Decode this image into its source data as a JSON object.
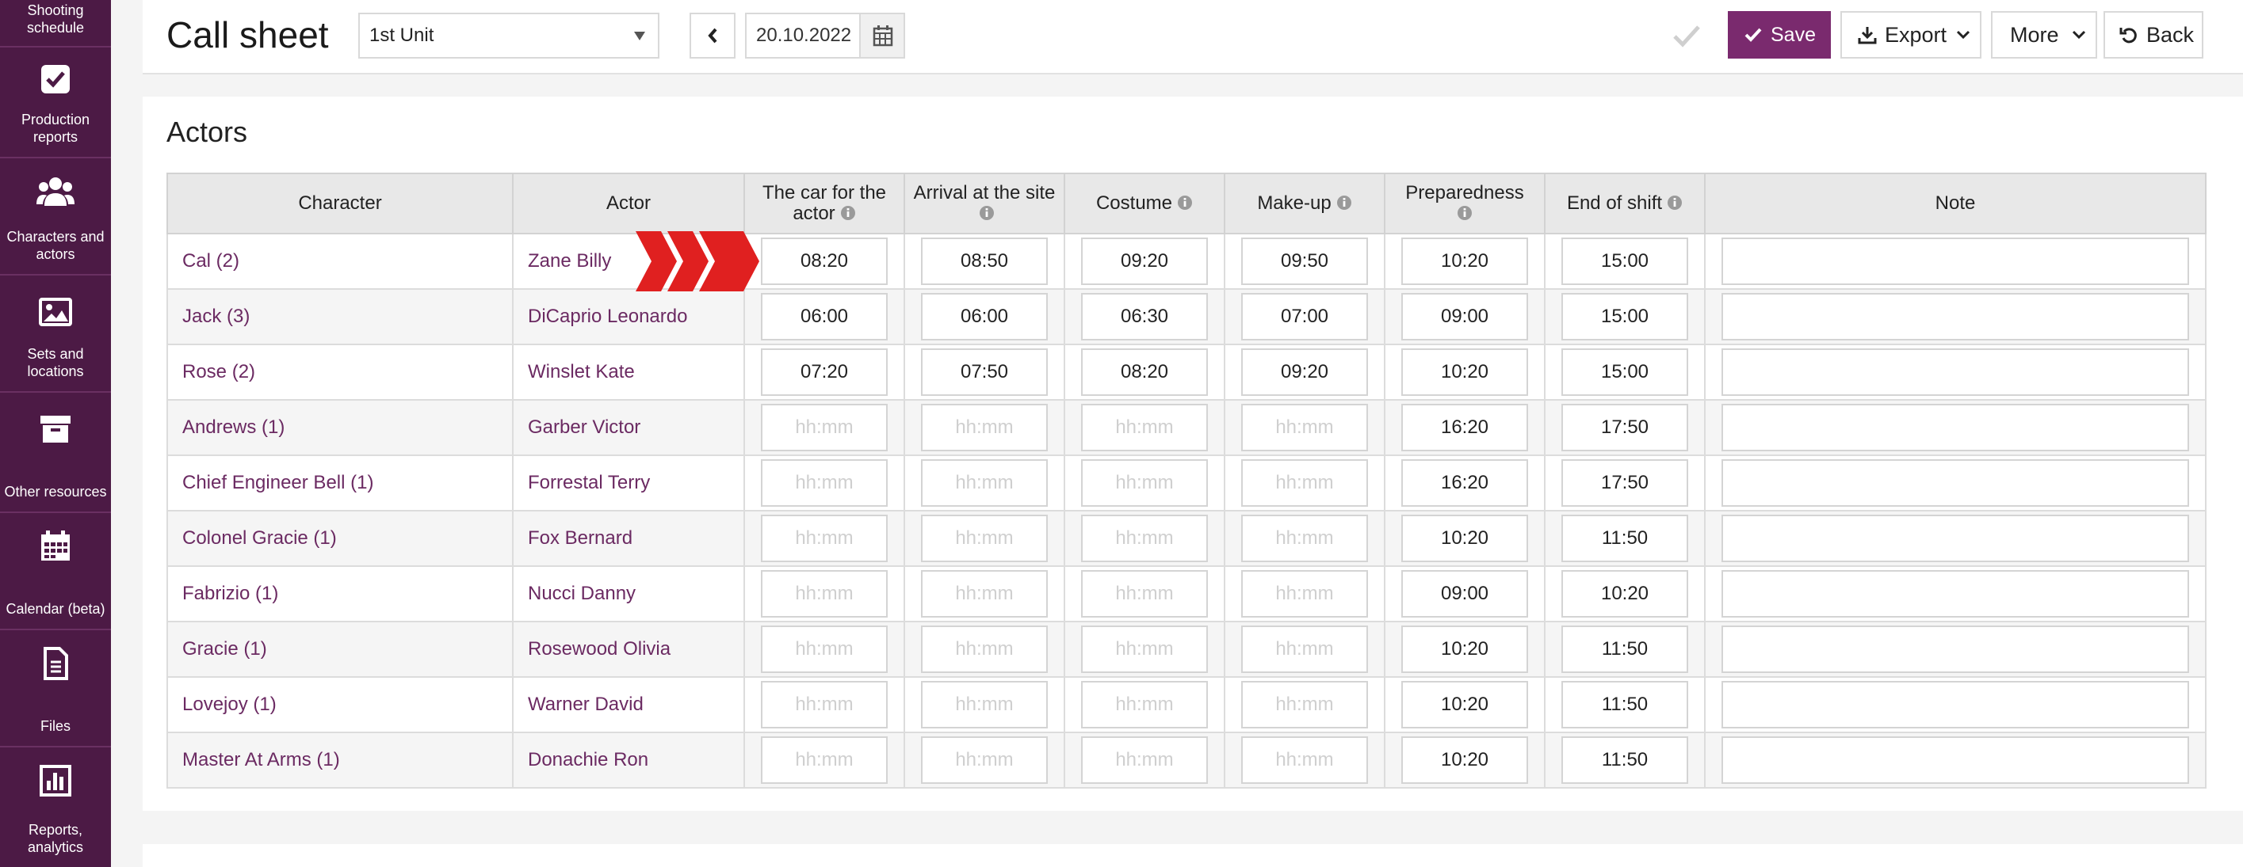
{
  "sidebar": {
    "items": [
      {
        "label": "Shooting schedule",
        "icon": "calendar-schedule-icon"
      },
      {
        "label": "Production reports",
        "icon": "checkbox-icon"
      },
      {
        "label": "Characters and actors",
        "icon": "users-icon"
      },
      {
        "label": "Sets and locations",
        "icon": "image-icon"
      },
      {
        "label": "Other resources",
        "icon": "archive-box-icon"
      },
      {
        "label": "Calendar (beta)",
        "icon": "calendar-icon"
      },
      {
        "label": "Files",
        "icon": "file-icon"
      },
      {
        "label": "Reports, analytics",
        "icon": "bar-chart-icon"
      }
    ]
  },
  "header": {
    "title": "Call sheet",
    "unit": "1st Unit",
    "date": "20.10.2022",
    "save_label": "Save",
    "export_label": "Export",
    "more_label": "More",
    "back_label": "Back"
  },
  "actors": {
    "title": "Actors",
    "columns": [
      "Character",
      "Actor",
      "The car for the actor",
      "Arrival at the site",
      "Costume",
      "Make-up",
      "Preparedness",
      "End of shift",
      "Note"
    ],
    "placeholder": "hh:mm",
    "rows": [
      {
        "character": "Cal (2)",
        "actor": "Zane Billy",
        "car": "08:20",
        "arrival": "08:50",
        "costume": "09:20",
        "makeup": "09:50",
        "prep": "10:20",
        "end": "15:00",
        "note": ""
      },
      {
        "character": "Jack (3)",
        "actor": "DiCaprio Leonardo",
        "car": "06:00",
        "arrival": "06:00",
        "costume": "06:30",
        "makeup": "07:00",
        "prep": "09:00",
        "end": "15:00",
        "note": ""
      },
      {
        "character": "Rose (2)",
        "actor": "Winslet Kate",
        "car": "07:20",
        "arrival": "07:50",
        "costume": "08:20",
        "makeup": "09:20",
        "prep": "10:20",
        "end": "15:00",
        "note": ""
      },
      {
        "character": "Andrews (1)",
        "actor": "Garber Victor",
        "car": "",
        "arrival": "",
        "costume": "",
        "makeup": "",
        "prep": "16:20",
        "end": "17:50",
        "note": ""
      },
      {
        "character": "Chief Engineer Bell (1)",
        "actor": "Forrestal Terry",
        "car": "",
        "arrival": "",
        "costume": "",
        "makeup": "",
        "prep": "16:20",
        "end": "17:50",
        "note": ""
      },
      {
        "character": "Colonel Gracie (1)",
        "actor": "Fox Bernard",
        "car": "",
        "arrival": "",
        "costume": "",
        "makeup": "",
        "prep": "10:20",
        "end": "11:50",
        "note": ""
      },
      {
        "character": "Fabrizio (1)",
        "actor": "Nucci Danny",
        "car": "",
        "arrival": "",
        "costume": "",
        "makeup": "",
        "prep": "09:00",
        "end": "10:20",
        "note": ""
      },
      {
        "character": "Gracie (1)",
        "actor": "Rosewood Olivia",
        "car": "",
        "arrival": "",
        "costume": "",
        "makeup": "",
        "prep": "10:20",
        "end": "11:50",
        "note": ""
      },
      {
        "character": "Lovejoy (1)",
        "actor": "Warner David",
        "car": "",
        "arrival": "",
        "costume": "",
        "makeup": "",
        "prep": "10:20",
        "end": "11:50",
        "note": ""
      },
      {
        "character": "Master At Arms (1)",
        "actor": "Donachie Ron",
        "car": "",
        "arrival": "",
        "costume": "",
        "makeup": "",
        "prep": "10:20",
        "end": "11:50",
        "note": ""
      }
    ]
  },
  "colors": {
    "brand": "#7a2a6e",
    "sidebar": "#4c1a45",
    "link": "#6b2a62",
    "arrow": "#e02020"
  }
}
